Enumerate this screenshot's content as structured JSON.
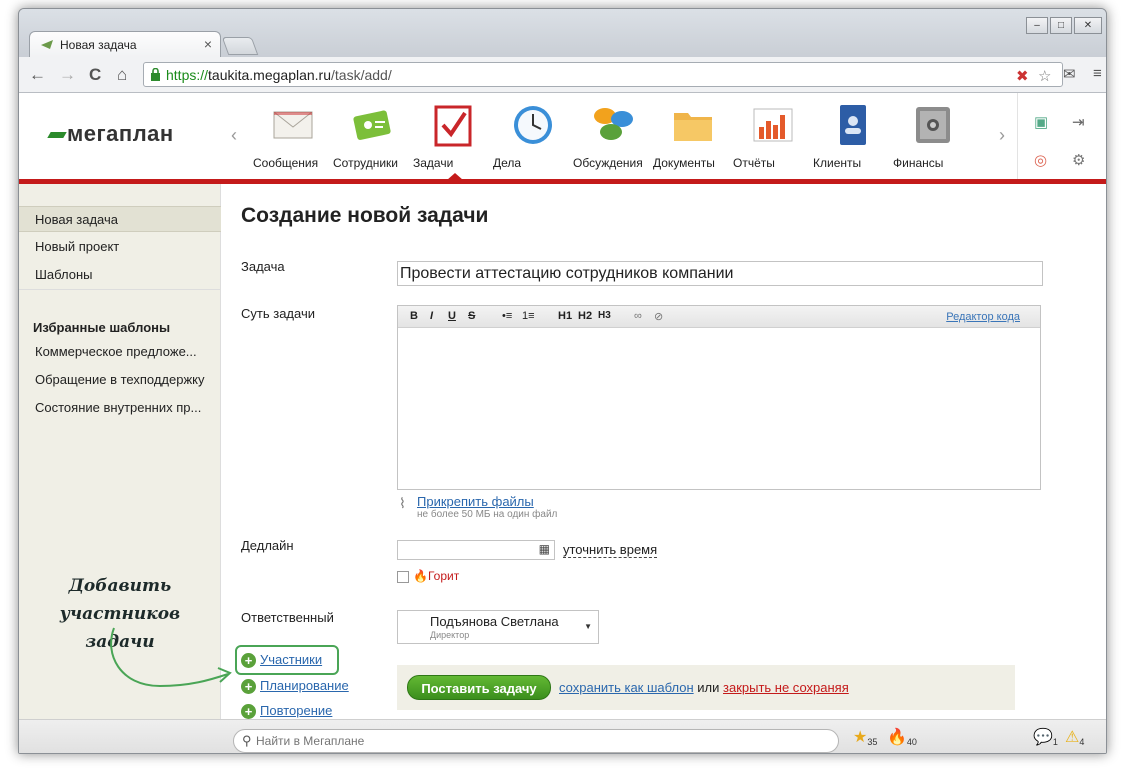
{
  "browser": {
    "tab_title": "Новая задача",
    "tab_close": "×",
    "url_scheme": "https://",
    "url_host": "taukita.megaplan.ru",
    "url_path": "/task/add/",
    "nav": {
      "back": "←",
      "forward": "→",
      "reload": "C",
      "home": "⌂"
    },
    "window_controls": [
      "–",
      "□",
      "✕"
    ]
  },
  "header": {
    "logo": "мегаплан",
    "modules": [
      {
        "label": "Сообщения",
        "icon": "envelope-icon",
        "color": "#e9e6df"
      },
      {
        "label": "Сотрудники",
        "icon": "id-card-icon",
        "color": "#7cbf3a"
      },
      {
        "label": "Задачи",
        "icon": "checkmark-icon",
        "color": "#c9262a"
      },
      {
        "label": "Дела",
        "icon": "clock-icon",
        "color": "#3a8fd8"
      },
      {
        "label": "Обсуждения",
        "icon": "chat-bubbles-icon",
        "color": "#f2a21d"
      },
      {
        "label": "Документы",
        "icon": "folder-icon",
        "color": "#f0b54a"
      },
      {
        "label": "Отчёты",
        "icon": "bar-chart-icon",
        "color": "#e45a2b"
      },
      {
        "label": "Клиенты",
        "icon": "address-book-icon",
        "color": "#2d5da6"
      },
      {
        "label": "Финансы",
        "icon": "safe-icon",
        "color": "#8c8c8c"
      }
    ]
  },
  "sidebar": {
    "items": [
      "Новая задача",
      "Новый проект",
      "Шаблоны"
    ],
    "favorites_heading": "Избранные шаблоны",
    "favorites": [
      "Коммерческое предложе...",
      "Обращение в техподдержку",
      "Состояние внутренних пр..."
    ]
  },
  "form": {
    "page_title": "Создание новой задачи",
    "task_label": "Задача",
    "task_value": "Провести аттестацию сотрудников компании",
    "essence_label": "Суть задачи",
    "editor_buttons": [
      "B",
      "I",
      "U",
      "S",
      "•≡",
      "1≡",
      "H1",
      "H2",
      "H3",
      "🔗",
      "⛓"
    ],
    "editor_code_link": "Редактор кода",
    "attach_link": "Прикрепить файлы",
    "attach_hint": "не более 50 МБ на один файл",
    "deadline_label": "Дедлайн",
    "deadline_value": "",
    "specify_time": "уточнить время",
    "burning_label": "Горит",
    "responsible_label": "Ответственный",
    "responsible_name": "Подъянова Светлана",
    "responsible_position": "Директор",
    "extras": [
      "Участники",
      "Планирование",
      "Повторение"
    ],
    "submit_label": "Поставить задачу",
    "save_template": "сохранить как шаблон",
    "or_text": "или",
    "close_no_save": "закрыть не сохраняя"
  },
  "annotation": {
    "line1": "Добавить",
    "line2": "участников задачи"
  },
  "statusbar": {
    "search_placeholder": "Найти в Мегаплане",
    "stars_count": "35",
    "fire_count": "40",
    "comments_count": "1",
    "warnings_count": "4"
  }
}
